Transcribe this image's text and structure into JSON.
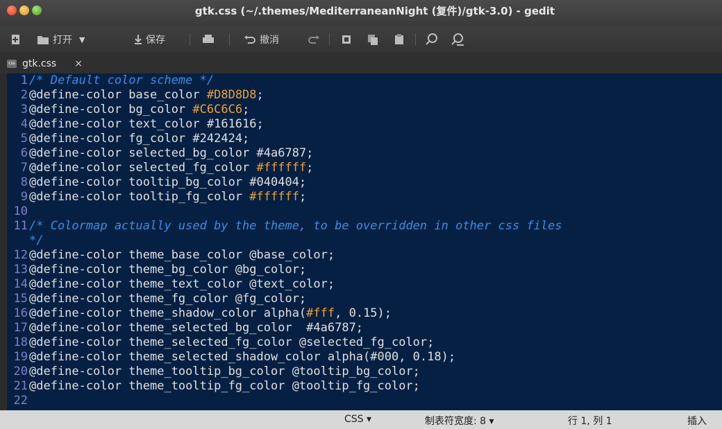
{
  "window": {
    "title": "gtk.css (~/.themes/MediterraneanNight (复件)/gtk-3.0) - gedit"
  },
  "toolbar": {
    "open_label": "打开",
    "save_label": "保存",
    "undo_label": "撤消"
  },
  "tab": {
    "label": "gtk.css",
    "icon_text": "css",
    "close": "×"
  },
  "status": {
    "language": "CSS ▾",
    "tab_width": "制表符宽度: 8 ▾",
    "position": "行 1, 列 1",
    "mode": "插入"
  },
  "lines": [
    {
      "n": "1",
      "segs": [
        {
          "t": "/* Default color scheme */",
          "c": "c"
        }
      ]
    },
    {
      "n": "2",
      "segs": [
        {
          "t": "@define-color base_color "
        },
        {
          "t": "#D8D8D8",
          "c": "o"
        },
        {
          "t": ";"
        }
      ]
    },
    {
      "n": "3",
      "segs": [
        {
          "t": "@define-color bg_color "
        },
        {
          "t": "#C6C6C6",
          "c": "o"
        },
        {
          "t": ";"
        }
      ]
    },
    {
      "n": "4",
      "segs": [
        {
          "t": "@define-color text_color #161616;"
        }
      ]
    },
    {
      "n": "5",
      "segs": [
        {
          "t": "@define-color fg_color #242424;"
        }
      ]
    },
    {
      "n": "6",
      "segs": [
        {
          "t": "@define-color selected_bg_color #4a6787;"
        }
      ]
    },
    {
      "n": "7",
      "segs": [
        {
          "t": "@define-color selected_fg_color "
        },
        {
          "t": "#ffffff",
          "c": "o"
        },
        {
          "t": ";"
        }
      ]
    },
    {
      "n": "8",
      "segs": [
        {
          "t": "@define-color tooltip_bg_color #040404;"
        }
      ]
    },
    {
      "n": "9",
      "segs": [
        {
          "t": "@define-color tooltip_fg_color "
        },
        {
          "t": "#ffffff",
          "c": "o"
        },
        {
          "t": ";"
        }
      ]
    },
    {
      "n": "10",
      "segs": []
    },
    {
      "n": "11",
      "segs": [
        {
          "t": "/* Colormap actually used by the theme, to be overridden in other css files",
          "c": "c"
        }
      ]
    },
    {
      "n": "",
      "segs": [
        {
          "t": "*/",
          "c": "c"
        }
      ]
    },
    {
      "n": "12",
      "segs": [
        {
          "t": "@define-color theme_base_color @base_color;"
        }
      ]
    },
    {
      "n": "13",
      "segs": [
        {
          "t": "@define-color theme_bg_color @bg_color;"
        }
      ]
    },
    {
      "n": "14",
      "segs": [
        {
          "t": "@define-color theme_text_color @text_color;"
        }
      ]
    },
    {
      "n": "15",
      "segs": [
        {
          "t": "@define-color theme_fg_color @fg_color;"
        }
      ]
    },
    {
      "n": "16",
      "segs": [
        {
          "t": "@define-color theme_shadow_color alpha("
        },
        {
          "t": "#fff",
          "c": "o"
        },
        {
          "t": ", 0.15);"
        }
      ]
    },
    {
      "n": "17",
      "segs": [
        {
          "t": "@define-color theme_selected_bg_color  #4a6787;"
        }
      ]
    },
    {
      "n": "18",
      "segs": [
        {
          "t": "@define-color theme_selected_fg_color @selected_fg_color;"
        }
      ]
    },
    {
      "n": "19",
      "segs": [
        {
          "t": "@define-color theme_selected_shadow_color alpha(#000, 0.18);"
        }
      ]
    },
    {
      "n": "20",
      "segs": [
        {
          "t": "@define-color theme_tooltip_bg_color @tooltip_bg_color;"
        }
      ]
    },
    {
      "n": "21",
      "segs": [
        {
          "t": "@define-color theme_tooltip_fg_color @tooltip_fg_color;"
        }
      ]
    },
    {
      "n": "22",
      "segs": []
    }
  ]
}
